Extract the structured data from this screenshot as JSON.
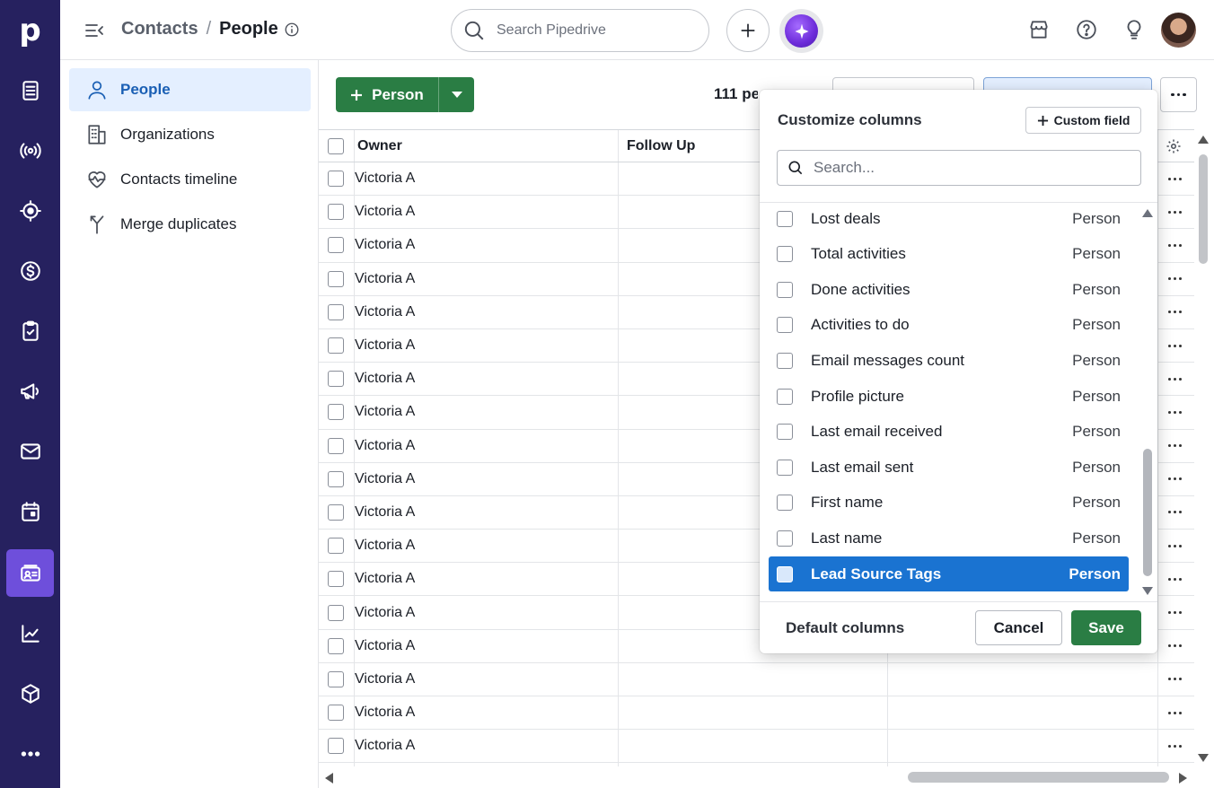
{
  "brand": {
    "logo_letter": "p",
    "accent": "#26215f",
    "active_rail": "#6e4fdb",
    "primary_green": "#2a7d44",
    "selection_blue": "#1a73d1"
  },
  "rail": [
    {
      "icon": "leads-icon"
    },
    {
      "icon": "broadcast-icon"
    },
    {
      "icon": "target-icon"
    },
    {
      "icon": "dollar-icon"
    },
    {
      "icon": "clipboard-check-icon"
    },
    {
      "icon": "megaphone-icon"
    },
    {
      "icon": "mail-icon"
    },
    {
      "icon": "calendar-icon"
    },
    {
      "icon": "contacts-card-icon",
      "active": true
    },
    {
      "icon": "chart-icon"
    },
    {
      "icon": "box-icon"
    },
    {
      "icon": "more-icon"
    }
  ],
  "header": {
    "breadcrumb_parent": "Contacts",
    "breadcrumb_sep": "/",
    "breadcrumb_current": "People",
    "search_placeholder": "Search Pipedrive"
  },
  "sidebar": {
    "items": [
      {
        "label": "People",
        "icon": "person-icon",
        "active": true
      },
      {
        "label": "Organizations",
        "icon": "building-icon"
      },
      {
        "label": "Contacts timeline",
        "icon": "heart-pulse-icon"
      },
      {
        "label": "Merge duplicates",
        "icon": "merge-icon"
      }
    ]
  },
  "toolbar": {
    "add_label": "Person",
    "count_label": "111 people"
  },
  "table": {
    "columns": [
      "Owner",
      "Follow Up"
    ],
    "rows": [
      "Victoria A",
      "Victoria A",
      "Victoria A",
      "Victoria A",
      "Victoria A",
      "Victoria A",
      "Victoria A",
      "Victoria A",
      "Victoria A",
      "Victoria A",
      "Victoria A",
      "Victoria A",
      "Victoria A",
      "Victoria A",
      "Victoria A",
      "Victoria A",
      "Victoria A",
      "Victoria A"
    ]
  },
  "customize": {
    "title": "Customize columns",
    "custom_field_label": "Custom field",
    "search_placeholder": "Search...",
    "items": [
      {
        "label": "Lost deals",
        "source": "Person"
      },
      {
        "label": "Total activities",
        "source": "Person"
      },
      {
        "label": "Done activities",
        "source": "Person"
      },
      {
        "label": "Activities to do",
        "source": "Person"
      },
      {
        "label": "Email messages count",
        "source": "Person"
      },
      {
        "label": "Profile picture",
        "source": "Person"
      },
      {
        "label": "Last email received",
        "source": "Person"
      },
      {
        "label": "Last email sent",
        "source": "Person"
      },
      {
        "label": "First name",
        "source": "Person"
      },
      {
        "label": "Last name",
        "source": "Person"
      },
      {
        "label": "Lead Source Tags",
        "source": "Person",
        "selected": true
      }
    ],
    "default_columns_label": "Default columns",
    "cancel_label": "Cancel",
    "save_label": "Save"
  }
}
